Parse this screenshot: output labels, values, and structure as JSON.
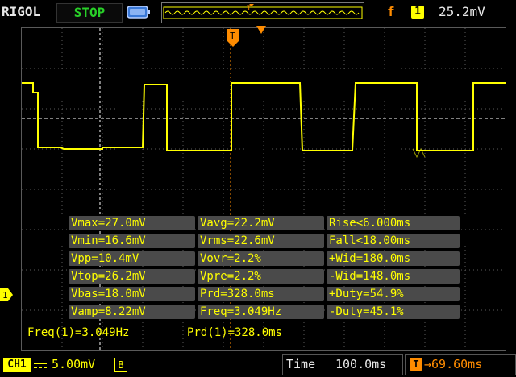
{
  "header": {
    "brand": "RIGOL",
    "run_state": "STOP",
    "trigger_edge_symbol": "f",
    "trigger_channel": "1",
    "trigger_level": "25.2mV"
  },
  "colors": {
    "channel1": "#ffff00",
    "trigger": "#ff8c00",
    "run_state": "#28d028",
    "grid": "#5a5a5a",
    "measure_bg": "#4a4a4a"
  },
  "measurements": {
    "rows": [
      [
        "Vmax=27.0mV",
        "Vavg=22.2mV",
        "Rise<6.000ms"
      ],
      [
        "Vmin=16.6mV",
        "Vrms=22.6mV",
        "Fall<18.00ms"
      ],
      [
        "Vpp=10.4mV",
        "Vovr=2.2%",
        "+Wid=180.0ms"
      ],
      [
        "Vtop=26.2mV",
        "Vpre=2.2%",
        "-Wid=148.0ms"
      ],
      [
        "Vbas=18.0mV",
        "Prd=328.0ms",
        "+Duty=54.9%"
      ],
      [
        "Vamp=8.22mV",
        "Freq=3.049Hz",
        "-Duty=45.1%"
      ]
    ],
    "freq_readout": "Freq(1)=3.049Hz",
    "prd_readout": "Prd(1)=328.0ms"
  },
  "footer": {
    "channel_label": "CH1",
    "volts_per_div": "5.00mV",
    "bandwidth_limit": "B",
    "time_label": "Time",
    "time_per_div": "100.0ms",
    "trigger_pos_icon": "T",
    "trigger_offset": "69.60ms"
  },
  "markers": {
    "channel_ground": "1",
    "trigger_time": "T"
  }
}
